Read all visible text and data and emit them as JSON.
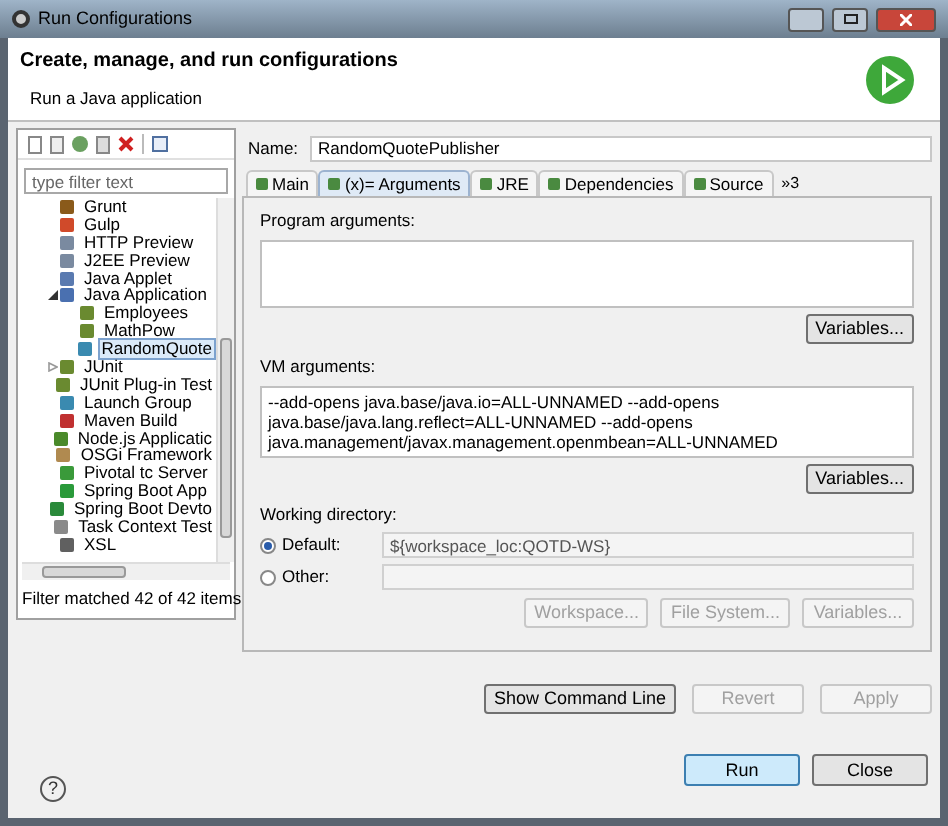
{
  "window": {
    "title": "Run Configurations"
  },
  "header": {
    "title": "Create, manage, and run configurations",
    "subtitle": "Run a Java application"
  },
  "filter": {
    "placeholder": "type filter text"
  },
  "tree": [
    {
      "label": "Grunt",
      "selected": false
    },
    {
      "label": "Gulp",
      "selected": false
    },
    {
      "label": "HTTP Preview",
      "selected": false
    },
    {
      "label": "J2EE Preview",
      "selected": false
    },
    {
      "label": "Java Applet",
      "selected": false
    },
    {
      "label": "Java Application",
      "selected": false,
      "expanded": true,
      "children": [
        {
          "label": "Employees",
          "selected": false
        },
        {
          "label": "MathPow",
          "selected": false
        },
        {
          "label": "RandomQuote",
          "selected": true
        }
      ]
    },
    {
      "label": "JUnit",
      "selected": false,
      "expanded": false
    },
    {
      "label": "JUnit Plug-in Test",
      "selected": false
    },
    {
      "label": "Launch Group",
      "selected": false
    },
    {
      "label": "Maven Build",
      "selected": false
    },
    {
      "label": "Node.js Applicatic",
      "selected": false
    },
    {
      "label": "OSGi Framework",
      "selected": false
    },
    {
      "label": "Pivotal tc Server",
      "selected": false
    },
    {
      "label": "Spring Boot App",
      "selected": false
    },
    {
      "label": "Spring Boot Devto",
      "selected": false
    },
    {
      "label": "Task Context Test",
      "selected": false
    },
    {
      "label": "XSL",
      "selected": false
    }
  ],
  "filter_status": "Filter matched 42 of 42 items",
  "name": {
    "label": "Name:",
    "value": "RandomQuotePublisher"
  },
  "tabs": [
    {
      "label": "Main",
      "selected": false
    },
    {
      "label": "(x)= Arguments",
      "selected": true
    },
    {
      "label": "JRE",
      "selected": false
    },
    {
      "label": "Dependencies",
      "selected": false
    },
    {
      "label": "Source",
      "selected": false
    }
  ],
  "tabs_overflow": "»3",
  "program_arguments": {
    "label": "Program arguments:",
    "button": "Variables..."
  },
  "vm_arguments": {
    "label": "VM arguments:",
    "value": "--add-opens java.base/java.io=ALL-UNNAMED --add-opens java.base/java.lang.reflect=ALL-UNNAMED --add-opens java.management/javax.management.openmbean=ALL-UNNAMED",
    "button": "Variables..."
  },
  "working_directory": {
    "label": "Working directory:",
    "options": [
      {
        "label": "Default:",
        "selected": true,
        "value": "${workspace_loc:QOTD-WS}"
      },
      {
        "label": "Other:",
        "selected": false
      }
    ],
    "buttons": [
      {
        "label": "Workspace...",
        "disabled": true
      },
      {
        "label": "File System...",
        "disabled": true
      },
      {
        "label": "Variables...",
        "disabled": true
      }
    ]
  },
  "actions": [
    {
      "label": "Show Command Line",
      "disabled": false
    },
    {
      "label": "Revert",
      "disabled": true
    },
    {
      "label": "Apply",
      "disabled": true
    }
  ],
  "help": "?",
  "footer": [
    {
      "label": "Run",
      "default": true
    },
    {
      "label": "Close",
      "default": false
    }
  ]
}
